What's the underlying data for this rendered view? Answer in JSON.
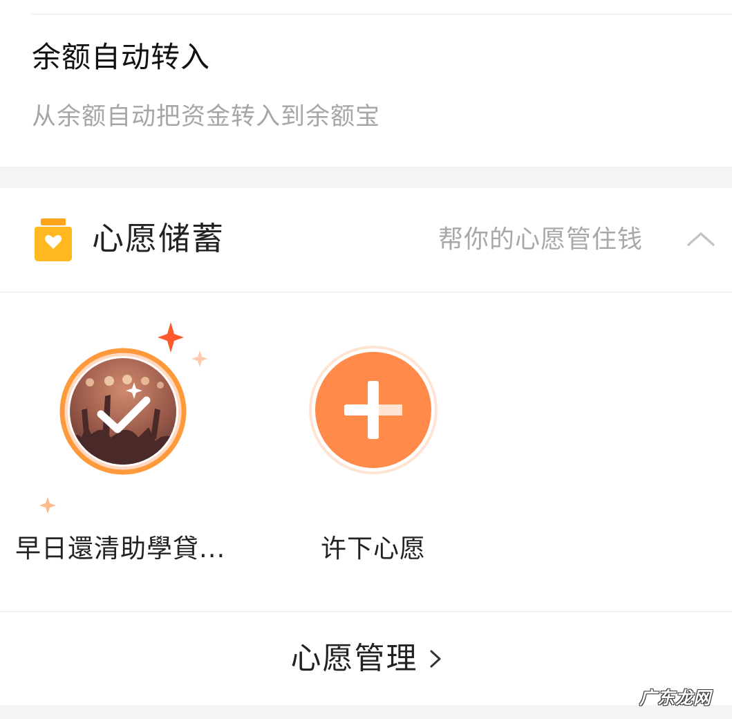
{
  "auto_transfer": {
    "title": "余额自动转入",
    "subtitle": "从余额自动把资金转入到余额宝"
  },
  "wish_savings": {
    "icon": "heart-jar-icon",
    "title": "心愿储蓄",
    "tagline": "帮你的心愿管住钱",
    "collapse_icon": "chevron-up-icon",
    "items": [
      {
        "label": "早日還清助學貸...",
        "icon": "check-icon",
        "status": "completed"
      },
      {
        "label": "许下心愿",
        "icon": "plus-icon"
      }
    ],
    "manage_label": "心愿管理",
    "manage_icon": "chevron-right-icon"
  },
  "watermark": "广东龙网",
  "colors": {
    "accent_orange": "#ff8a4a",
    "ring_orange": "#ff9a3c",
    "jar_yellow": "#ffb31a",
    "sparkle_red": "#ff5a2c",
    "text_gray": "#a6a6a6"
  }
}
